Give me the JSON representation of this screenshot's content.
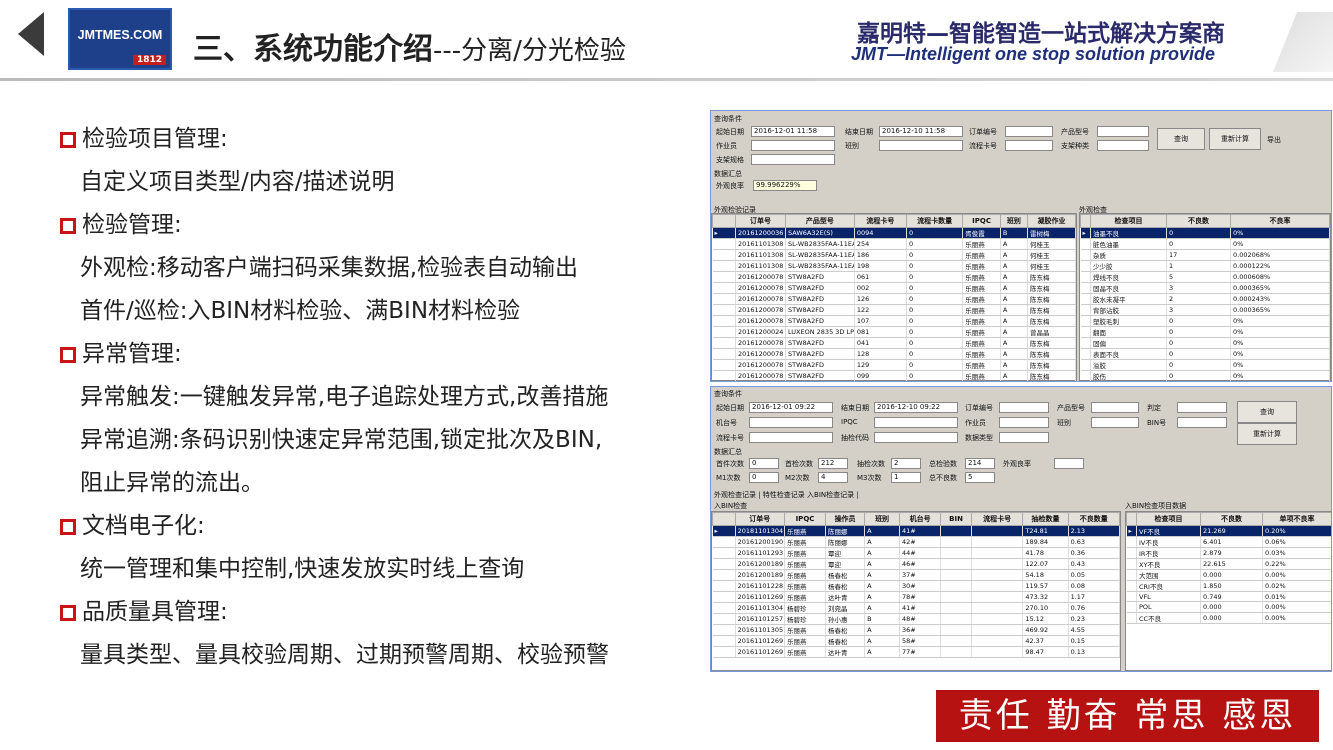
{
  "header": {
    "logo_text": "JMTMES.COM",
    "logo_year": "1812",
    "title_main": "三、系统功能介绍",
    "title_sub": "---分离/分光检验",
    "brand_cn": "嘉明特—智能智造一站式解决方案商",
    "brand_en": "JMT—Intelligent one stop solution provide"
  },
  "content": [
    {
      "type": "h",
      "text": "检验项目管理:"
    },
    {
      "type": "i",
      "text": "自定义项目类型/内容/描述说明"
    },
    {
      "type": "h",
      "text": "检验管理:"
    },
    {
      "type": "i",
      "text": "外观检:移动客户端扫码采集数据,检验表自动输出"
    },
    {
      "type": "i",
      "text": "首件/巡检:入BIN材料检验、满BIN材料检验"
    },
    {
      "type": "h",
      "text": "异常管理:"
    },
    {
      "type": "i",
      "text": "异常触发:一键触发异常,电子追踪处理方式,改善措施"
    },
    {
      "type": "i",
      "text": "异常追溯:条码识别快速定异常范围,锁定批次及BIN,"
    },
    {
      "type": "i",
      "text": "阻止异常的流出。"
    },
    {
      "type": "h",
      "text": "文档电子化:"
    },
    {
      "type": "i",
      "text": "统一管理和集中控制,快速发放实时线上查询"
    },
    {
      "type": "h",
      "text": "品质量具管理:"
    },
    {
      "type": "i",
      "text": "量具类型、量具校验周期、过期预警周期、校验预警"
    }
  ],
  "motto": "责任 勤奋 常思 感恩",
  "win1": {
    "query_title": "查询条件",
    "start_label": "起始日期",
    "start_value": "2016-12-01 11:58",
    "end_label": "结束日期",
    "end_value": "2016-12-10 11:58",
    "order_label": "订单编号",
    "model_label": "产品型号",
    "worker_label": "作业员",
    "shift_label": "班别",
    "flowcard_label": "流程卡号",
    "bracket_label": "支架种类",
    "bracket_spec_label": "支架规格",
    "query_btn": "查询",
    "recalc_btn": "重新计算",
    "export_btn": "导出",
    "summary_title": "数据汇总",
    "yield_label": "外观良率",
    "yield_value": "99.996229%",
    "left_title": "外观检验记录",
    "right_title": "外观检查",
    "left_cols": [
      "订单号",
      "产品型号",
      "流程卡号",
      "流程卡数量",
      "IPQC",
      "班别",
      "凝胶作业"
    ],
    "left_rows": [
      [
        "20161200036",
        "SAW6A32E(S)",
        "0094",
        "0",
        "胥俊霞",
        "B",
        "雷树梅"
      ],
      [
        "20161101308",
        "SL-WB2835FAA-11EAI",
        "254",
        "0",
        "乐丽燕",
        "A",
        "何桂玉"
      ],
      [
        "20161101308",
        "SL-WB2835FAA-11EAI",
        "186",
        "0",
        "乐丽燕",
        "A",
        "何桂玉"
      ],
      [
        "20161101308",
        "SL-WB2835FAA-11EAI",
        "198",
        "0",
        "乐丽燕",
        "A",
        "何桂玉"
      ],
      [
        "20161200078",
        "STW8A2FD",
        "061",
        "0",
        "乐丽燕",
        "A",
        "陈东梅"
      ],
      [
        "20161200078",
        "STW8A2FD",
        "002",
        "0",
        "乐丽燕",
        "A",
        "陈东梅"
      ],
      [
        "20161200078",
        "STW8A2FD",
        "126",
        "0",
        "乐丽燕",
        "A",
        "陈东梅"
      ],
      [
        "20161200078",
        "STW8A2FD",
        "122",
        "0",
        "乐丽燕",
        "A",
        "陈东梅"
      ],
      [
        "20161200078",
        "STW8A2FD",
        "107",
        "0",
        "乐丽燕",
        "A",
        "陈东梅"
      ],
      [
        "20161200024",
        "LUXEON 2835 3D LP",
        "081",
        "0",
        "乐丽燕",
        "A",
        "曾晶晶"
      ],
      [
        "20161200078",
        "STW8A2FD",
        "041",
        "0",
        "乐丽燕",
        "A",
        "陈东梅"
      ],
      [
        "20161200078",
        "STW8A2FD",
        "128",
        "0",
        "乐丽燕",
        "A",
        "陈东梅"
      ],
      [
        "20161200078",
        "STW8A2FD",
        "129",
        "0",
        "乐丽燕",
        "A",
        "陈东梅"
      ],
      [
        "20161200078",
        "STW8A2FD",
        "099",
        "0",
        "乐丽燕",
        "A",
        "陈东梅"
      ]
    ],
    "right_cols": [
      "检查项目",
      "不良数",
      "不良率"
    ],
    "right_rows": [
      [
        "油墨不良",
        "0",
        "0%"
      ],
      [
        "脏色油墨",
        "0",
        "0%"
      ],
      [
        "杂质",
        "17",
        "0.002068%"
      ],
      [
        "少少胶",
        "1",
        "0.000122%"
      ],
      [
        "焊线不良",
        "5",
        "0.000608%"
      ],
      [
        "固晶不良",
        "3",
        "0.000365%"
      ],
      [
        "胶水未凝平",
        "2",
        "0.000243%"
      ],
      [
        "背部沾胶",
        "3",
        "0.000365%"
      ],
      [
        "塑胶毛刺",
        "0",
        "0%"
      ],
      [
        "翻面",
        "0",
        "0%"
      ],
      [
        "固偏",
        "0",
        "0%"
      ],
      [
        "表面不良",
        "0",
        "0%"
      ],
      [
        "溢胶",
        "0",
        "0%"
      ],
      [
        "胶伤",
        "0",
        "0%"
      ]
    ]
  },
  "win2": {
    "query_title": "查询条件",
    "start_label": "起始日期",
    "start_value": "2016-12-01 09:22",
    "end_label": "结束日期",
    "end_value": "2016-12-10 09:22",
    "order_label": "订单编号",
    "model_label": "产品型号",
    "judge_label": "判定",
    "machine_label": "机台号",
    "ipqc_label": "IPQC",
    "worker_label": "作业员",
    "shift_label": "班别",
    "bin_label": "BIN号",
    "flowcard_label": "流程卡号",
    "sample_label": "抽检代码",
    "datatype_label": "数据类型",
    "query_btn": "查询",
    "recalc_btn": "重新计算",
    "summary_title": "数据汇总",
    "first_count_label": "首件次数",
    "first_count_value": "0",
    "first_check_label": "首检次数",
    "first_check_value": "212",
    "sample_count_label": "抽检次数",
    "sample_count_value": "2",
    "total_check_label": "总检验数",
    "total_check_value": "214",
    "yield_label": "外观良率",
    "m1_label": "M1次数",
    "m1_value": "0",
    "m2_label": "M2次数",
    "m2_value": "4",
    "m3_label": "M3次数",
    "m3_value": "1",
    "total_bad_label": "总不良数",
    "total_bad_value": "5",
    "tabs": "外观检查记录 | 特性检查记录  入BIN检查记录 |",
    "left_title": "入BIN检查",
    "right_title": "入BIN检查项目数据",
    "left_cols": [
      "订单号",
      "IPQC",
      "操作员",
      "班别",
      "机台号",
      "BIN",
      "流程卡号",
      "抽检数量",
      "不良数量"
    ],
    "left_rows": [
      [
        "20181101304",
        "乐丽燕",
        "陈丽娜",
        "A",
        "41#",
        "",
        "",
        "T24.81",
        "2.13"
      ],
      [
        "20161200190",
        "乐丽燕",
        "陈丽娜",
        "A",
        "42#",
        "",
        "",
        "189.84",
        "0.63"
      ],
      [
        "20161101293",
        "乐丽燕",
        "覃迎",
        "A",
        "44#",
        "",
        "",
        "41.78",
        "0.36"
      ],
      [
        "20161200189",
        "乐丽燕",
        "覃迎",
        "A",
        "46#",
        "",
        "",
        "122.07",
        "0.43"
      ],
      [
        "20161200189",
        "乐丽燕",
        "杨春松",
        "A",
        "37#",
        "",
        "",
        "54.18",
        "0.05"
      ],
      [
        "20161101228",
        "乐丽燕",
        "杨春松",
        "A",
        "30#",
        "",
        "",
        "119.57",
        "0.08"
      ],
      [
        "20161101269",
        "乐丽燕",
        "达叶青",
        "A",
        "78#",
        "",
        "",
        "473.32",
        "1.17"
      ],
      [
        "20161101304",
        "杨碧珍",
        "刘宛晶",
        "A",
        "41#",
        "",
        "",
        "270.10",
        "0.76"
      ],
      [
        "20161101257",
        "杨碧珍",
        "孙小惠",
        "B",
        "48#",
        "",
        "",
        "15.12",
        "0.23"
      ],
      [
        "20161101305",
        "乐丽燕",
        "杨春松",
        "A",
        "36#",
        "",
        "",
        "469.92",
        "4.55"
      ],
      [
        "20161101269",
        "乐丽燕",
        "杨春松",
        "A",
        "58#",
        "",
        "",
        "42.37",
        "0.15"
      ],
      [
        "20161101269",
        "乐丽燕",
        "达叶青",
        "A",
        "77#",
        "",
        "",
        "98.47",
        "0.13"
      ]
    ],
    "right_cols": [
      "检查项目",
      "不良数",
      "单项不良率"
    ],
    "right_rows": [
      [
        "VF不良",
        "21.269",
        "0.20%"
      ],
      [
        "IV不良",
        "6.401",
        "0.06%"
      ],
      [
        "IR不良",
        "2.879",
        "0.03%"
      ],
      [
        "XY不良",
        "22.615",
        "0.22%"
      ],
      [
        "大范围",
        "0.000",
        "0.00%"
      ],
      [
        "CRI不良",
        "1.850",
        "0.02%"
      ],
      [
        "VFL",
        "0.749",
        "0.01%"
      ],
      [
        "POL",
        "0.000",
        "0.00%"
      ],
      [
        "CC不良",
        "0.000",
        "0.00%"
      ]
    ]
  }
}
